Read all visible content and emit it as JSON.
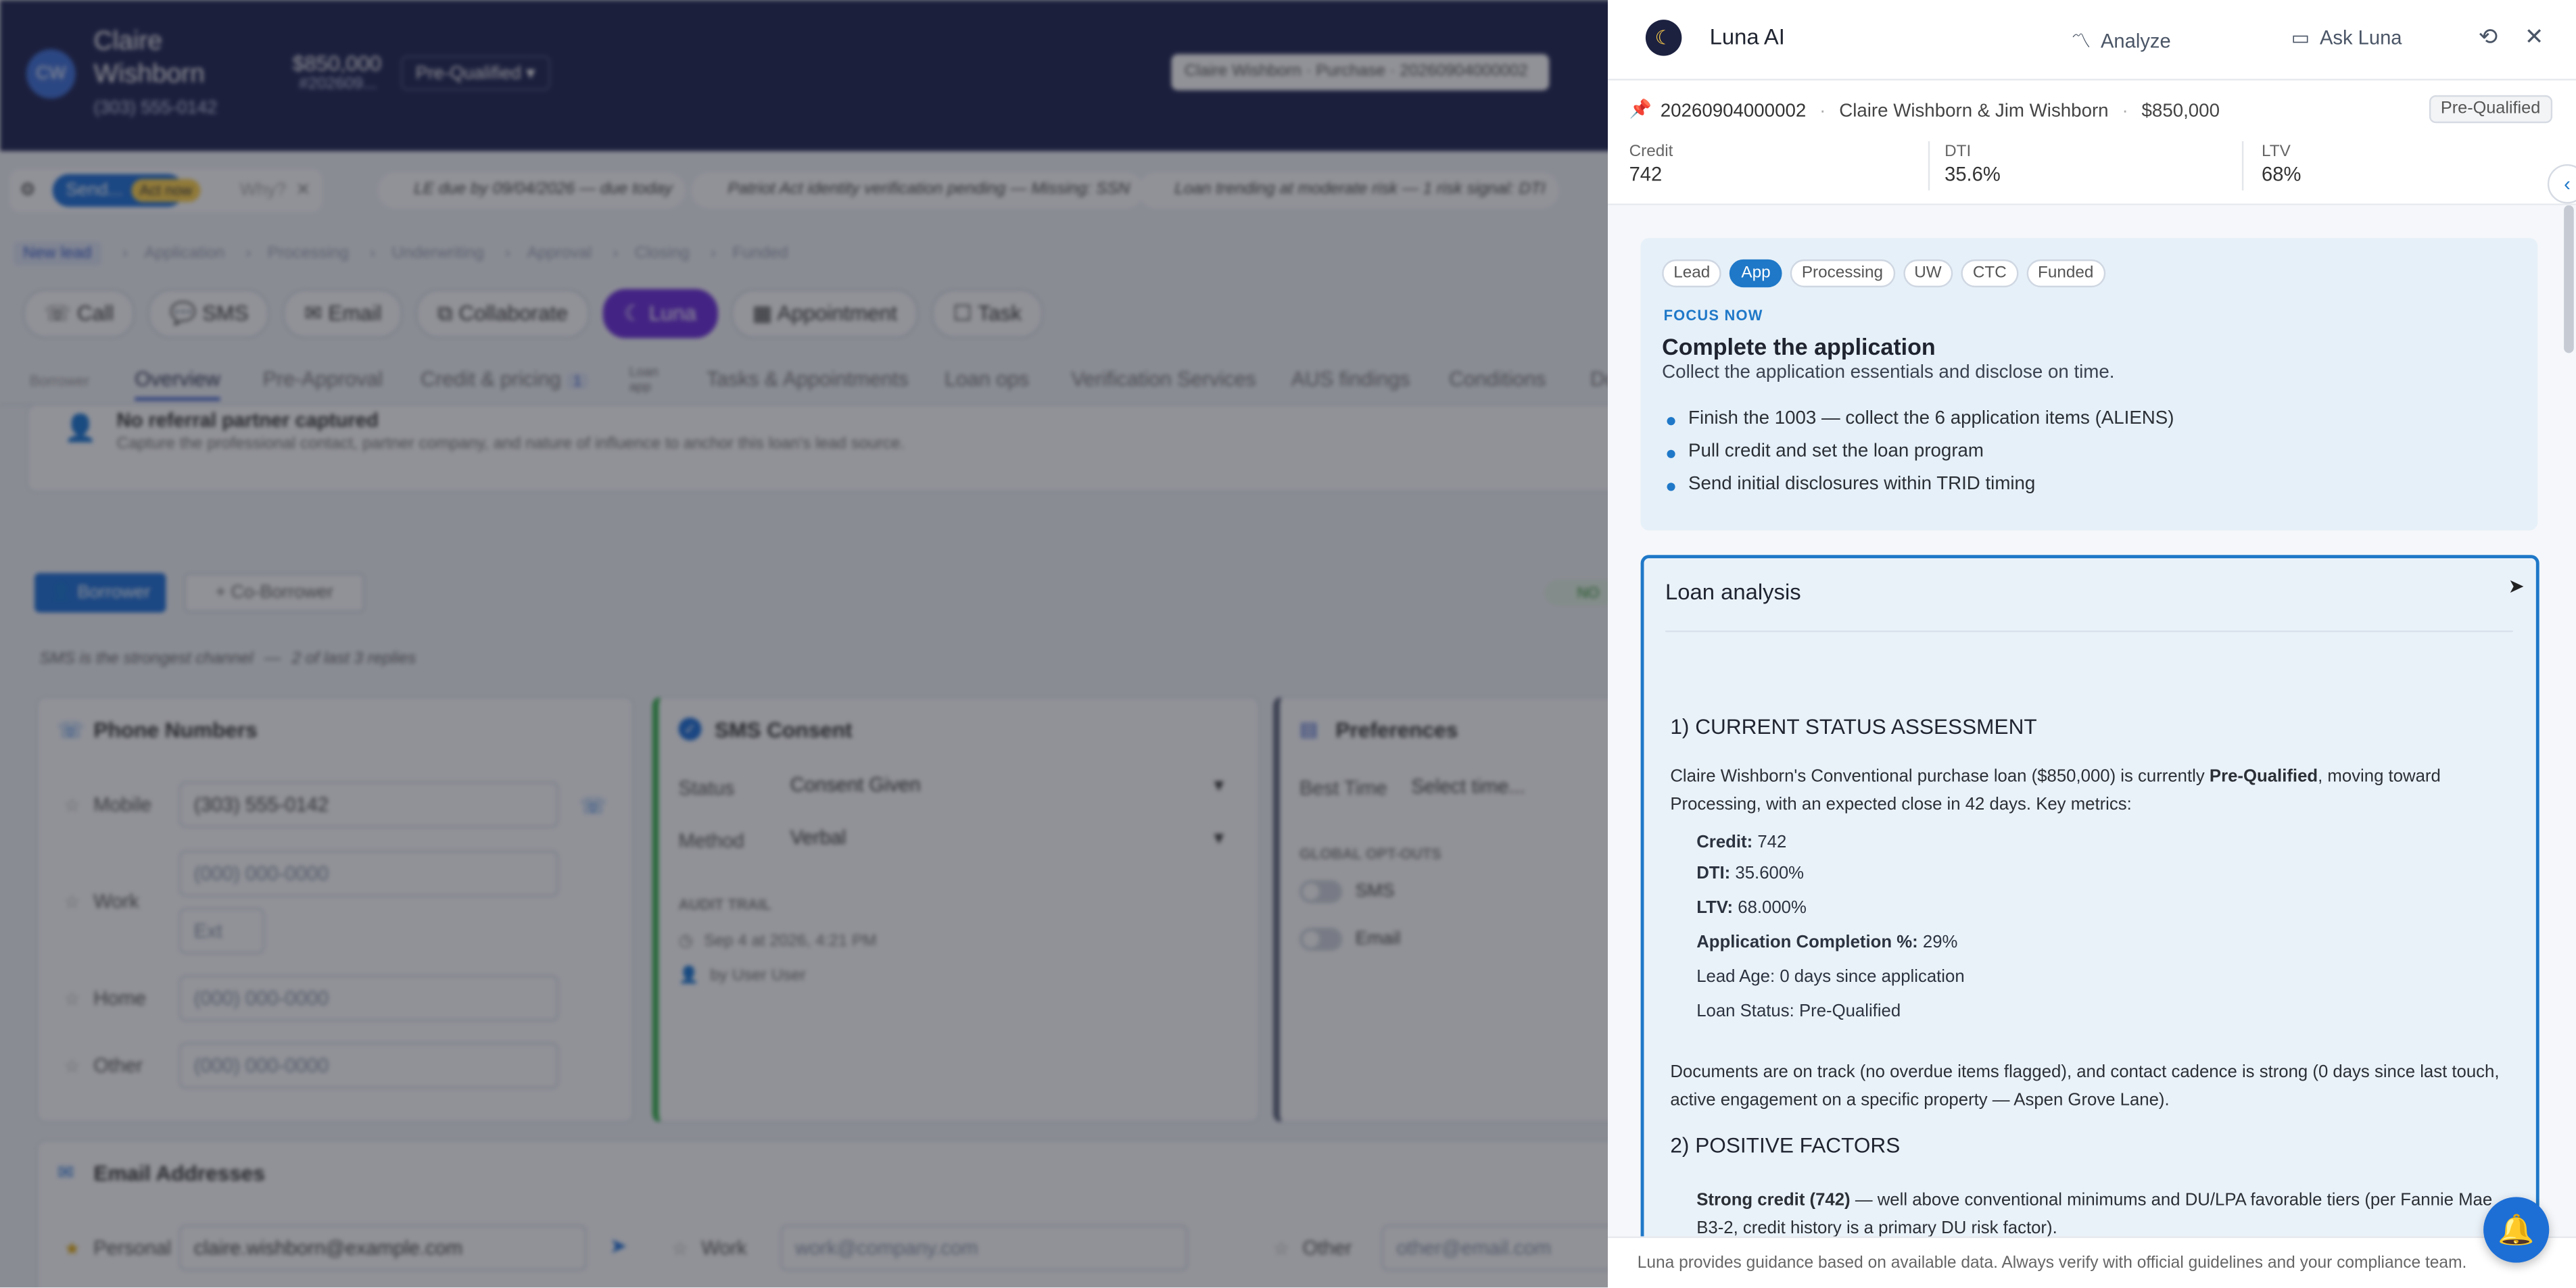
{
  "background": {
    "header": {
      "avatar_initials": "CW",
      "name": "Claire Wishborn",
      "phone": "(303) 555-0142",
      "amount": "$850,000",
      "loan_num_short": "#202609...",
      "status_select": "Pre-Qualified",
      "loan_selector": "Claire Wishborn · Purchase · 20260904000002"
    },
    "alerts_bar": {
      "send_label": "Send...",
      "act_now": "Act now",
      "why": "Why?",
      "alerts": [
        "LE due by 09/04/2026 — due today",
        "Patriot Act identity verification pending — Missing: SSN",
        "Loan trending at moderate risk — 1 risk signal: DTI"
      ]
    },
    "stages": [
      "New lead",
      "Application",
      "Processing",
      "Underwriting",
      "Approval",
      "Closing",
      "Funded"
    ],
    "actions": [
      "Call",
      "SMS",
      "Email",
      "Collaborate",
      "Luna",
      "Appointment",
      "Task"
    ],
    "tabs": {
      "borrower": "Borrower",
      "items": [
        "Overview",
        "Pre-Approval",
        "Credit & pricing",
        "Loan app",
        "Tasks & Appointments",
        "Loan ops",
        "Verification Services",
        "AUS findings",
        "Conditions",
        "Do"
      ],
      "credit_badge": "1"
    },
    "referral": {
      "title": "No referral partner captured",
      "desc": "Capture the professional contact, partner company, and nature of influence to anchor this loan's lead source."
    },
    "borrower_btn": "Borrower",
    "coborrower_btn": "+ Co-Borrower",
    "sms_hint": "SMS is the strongest channel",
    "sms_hint_detail": "2 of last 3 replies",
    "status_right": "NO",
    "phones": {
      "title": "Phone Numbers",
      "rows": [
        {
          "label": "Mobile",
          "value": "(303) 555-0142"
        },
        {
          "label": "Work",
          "value": "(000) 000-0000",
          "ext": "Ext"
        },
        {
          "label": "Home",
          "value": "(000) 000-0000"
        },
        {
          "label": "Other",
          "value": "(000) 000-0000"
        }
      ]
    },
    "sms_consent": {
      "title": "SMS Consent",
      "status_label": "Status",
      "status_value": "Consent Given",
      "method_label": "Method",
      "method_value": "Verbal",
      "audit_label": "AUDIT TRAIL",
      "audit_time": "Sep 4 at 2026, 4:21 PM",
      "audit_user": "by User User"
    },
    "preferences": {
      "title": "Preferences",
      "best_time_label": "Best Time",
      "best_time_value": "Select time...",
      "optouts_label": "GLOBAL OPT-OUTS",
      "sms": "SMS",
      "email": "Email"
    },
    "emails": {
      "title": "Email Addresses",
      "personal_label": "Personal",
      "personal_value": "claire.wishborn@example.com",
      "work_label": "Work",
      "work_placeholder": "work@company.com",
      "other_label": "Other",
      "other_placeholder": "other@email.com"
    }
  },
  "panel": {
    "title": "Luna AI",
    "analyze": "Analyze",
    "ask": "Ask Luna",
    "loan_number": "20260904000002",
    "borrowers": "Claire Wishborn & Jim Wishborn",
    "amount": "$850,000",
    "status": "Pre-Qualified",
    "metrics": [
      {
        "label": "Credit",
        "value": "742"
      },
      {
        "label": "DTI",
        "value": "35.6%"
      },
      {
        "label": "LTV",
        "value": "68%"
      }
    ],
    "stages": [
      "Lead",
      "App",
      "Processing",
      "UW",
      "CTC",
      "Funded"
    ],
    "active_stage": "App",
    "focus_label": "FOCUS NOW",
    "focus_title": "Complete the application",
    "focus_desc": "Collect the application essentials and disclose on time.",
    "focus_items": [
      "Finish the 1003 — collect the 6 application items (ALIENS)",
      "Pull credit and set the loan program",
      "Send initial disclosures within TRID timing"
    ],
    "analysis": {
      "title": "Loan analysis",
      "h1": "1) CURRENT STATUS ASSESSMENT",
      "intro_a": "Claire Wishborn's Conventional purchase loan ($850,000) is currently ",
      "intro_b": "Pre-Qualified",
      "intro_c": ", moving toward Processing, with an expected close in 42 days. Key metrics:",
      "metrics": [
        {
          "k": "Credit:",
          "v": "742",
          "bold": true
        },
        {
          "k": "DTI:",
          "v": "35.600%",
          "bold": true
        },
        {
          "k": "LTV:",
          "v": "68.000%",
          "bold": true
        },
        {
          "k": "Application Completion %:",
          "v": "29%",
          "bold": true
        },
        {
          "k": "Lead Age:",
          "v": "0 days since application",
          "bold": false
        },
        {
          "k": "Loan Status:",
          "v": "Pre-Qualified",
          "bold": false
        }
      ],
      "docs": "Documents are on track (no overdue items flagged), and contact cadence is strong (0 days since last touch, active engagement on a specific property — Aspen Grove Lane).",
      "h2": "2) POSITIVE FACTORS",
      "pos_b": "Strong credit (742)",
      "pos_rest": " — well above conventional minimums and DU/LPA favorable tiers (per Fannie Mae B3-2, credit history is a primary DU risk factor)."
    },
    "footer": "Luna provides guidance based on available data. Always verify with official guidelines and your compliance team."
  }
}
